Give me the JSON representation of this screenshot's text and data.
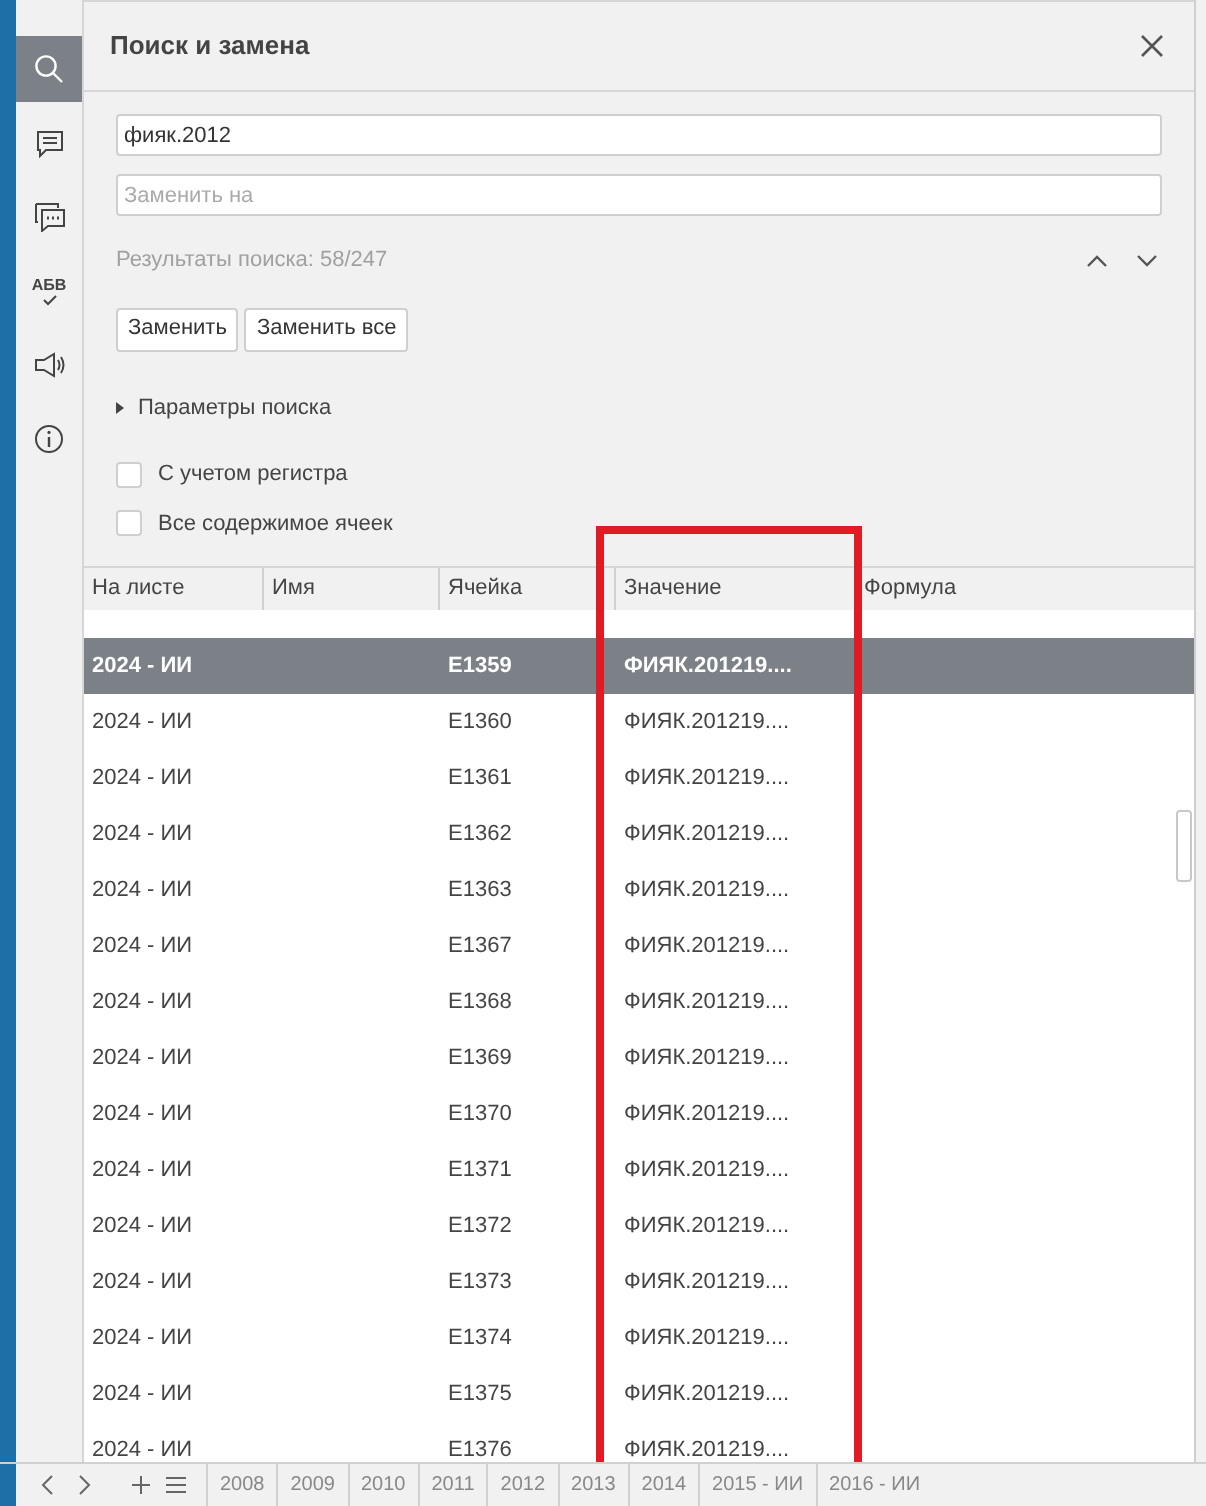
{
  "sidebar": {
    "items": [
      {
        "kind": "search",
        "selected": true
      },
      {
        "kind": "comment",
        "selected": false
      },
      {
        "kind": "chat",
        "selected": false
      },
      {
        "kind": "spellcheck",
        "label": "АБВ",
        "selected": false
      },
      {
        "kind": "feedback",
        "selected": false
      },
      {
        "kind": "info",
        "selected": false
      }
    ]
  },
  "panel": {
    "title": "Поиск и замена",
    "search": {
      "value": "фияк.2012"
    },
    "replace": {
      "placeholder": "Заменить на"
    },
    "results": "Результаты поиска: 58/247",
    "buttons": [
      "Заменить",
      "Заменить все"
    ],
    "options": {
      "label": "Параметры поиска",
      "expanded": false
    },
    "checkboxes": [
      {
        "label": "С учетом регистра",
        "checked": false
      },
      {
        "label": "Все содержимое ячеек",
        "checked": false
      }
    ]
  },
  "table": {
    "columns": [
      "На листе",
      "Имя",
      "Ячейка",
      "Значение",
      "Формула"
    ],
    "rows": [
      {
        "sheet": "2024 - ИИ",
        "cell": "E1359",
        "value": "ФИЯК.201219....",
        "selected": true
      },
      {
        "sheet": "2024 - ИИ",
        "cell": "E1360",
        "value": "ФИЯК.201219....",
        "selected": false
      },
      {
        "sheet": "2024 - ИИ",
        "cell": "E1361",
        "value": "ФИЯК.201219....",
        "selected": false
      },
      {
        "sheet": "2024 - ИИ",
        "cell": "E1362",
        "value": "ФИЯК.201219....",
        "selected": false
      },
      {
        "sheet": "2024 - ИИ",
        "cell": "E1363",
        "value": "ФИЯК.201219....",
        "selected": false
      },
      {
        "sheet": "2024 - ИИ",
        "cell": "E1367",
        "value": "ФИЯК.201219....",
        "selected": false
      },
      {
        "sheet": "2024 - ИИ",
        "cell": "E1368",
        "value": "ФИЯК.201219....",
        "selected": false
      },
      {
        "sheet": "2024 - ИИ",
        "cell": "E1369",
        "value": "ФИЯК.201219....",
        "selected": false
      },
      {
        "sheet": "2024 - ИИ",
        "cell": "E1370",
        "value": "ФИЯК.201219....",
        "selected": false
      },
      {
        "sheet": "2024 - ИИ",
        "cell": "E1371",
        "value": "ФИЯК.201219....",
        "selected": false
      },
      {
        "sheet": "2024 - ИИ",
        "cell": "E1372",
        "value": "ФИЯК.201219....",
        "selected": false
      },
      {
        "sheet": "2024 - ИИ",
        "cell": "E1373",
        "value": "ФИЯК.201219....",
        "selected": false
      },
      {
        "sheet": "2024 - ИИ",
        "cell": "E1374",
        "value": "ФИЯК.201219....",
        "selected": false
      },
      {
        "sheet": "2024 - ИИ",
        "cell": "E1375",
        "value": "ФИЯК.201219....",
        "selected": false
      },
      {
        "sheet": "2024 - ИИ",
        "cell": "E1376",
        "value": "ФИЯК.201219....",
        "selected": false
      }
    ]
  },
  "sheet_tabs": [
    "2008",
    "2009",
    "2010",
    "2011",
    "2012",
    "2013",
    "2014",
    "2015 - ИИ",
    "2016 - ИИ"
  ]
}
